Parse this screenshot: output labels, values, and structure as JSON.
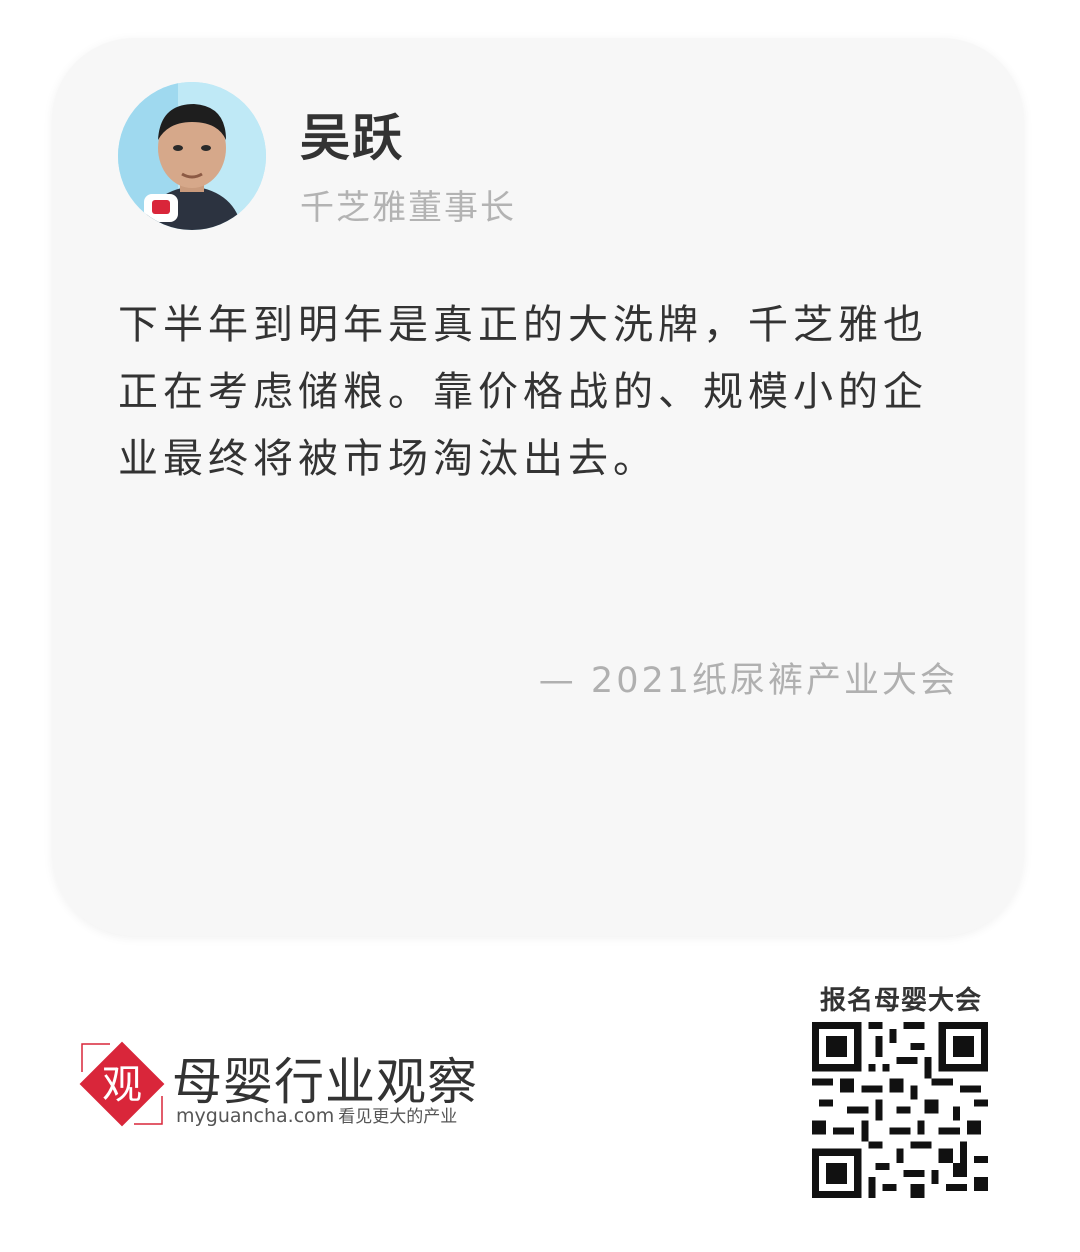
{
  "speaker": {
    "name": "吴跃",
    "title": "千芝雅董事长"
  },
  "quote": {
    "text": "下半年到明年是真正的大洗牌，千芝雅也正在考虑储粮。靠价格战的、规模小的企业最终将被市场淘汰出去。",
    "source": "— 2021纸尿裤产业大会"
  },
  "brand": {
    "mark_char": "观",
    "name": "母婴行业观察",
    "url": "myguancha.com",
    "slogan": "看见更大的产业",
    "accent_color": "#d9263a"
  },
  "qr": {
    "label": "报名母婴大会",
    "icon": "qr-code-icon"
  },
  "colors": {
    "card_background": "#f7f7f7",
    "text_primary": "#333333",
    "text_secondary": "#b3b3b3"
  }
}
